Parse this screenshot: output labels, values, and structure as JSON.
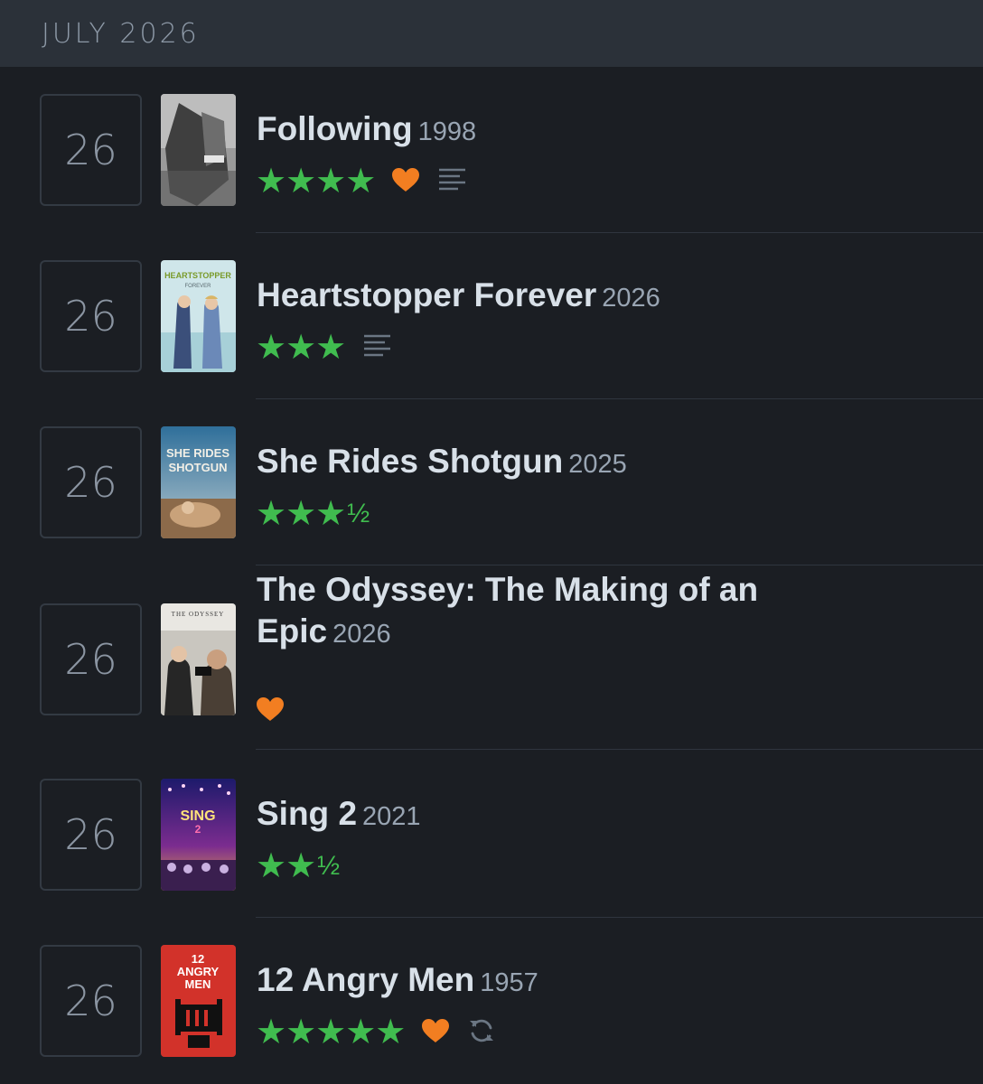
{
  "header": {
    "month": "JULY 2026"
  },
  "colors": {
    "star": "#40bc4f",
    "heart": "#f27e21",
    "icon": "#6b7683"
  },
  "entries": [
    {
      "day": "26",
      "title": "Following",
      "year": "1998",
      "rating": "★★★★",
      "liked": true,
      "review": true,
      "rewatch": false
    },
    {
      "day": "26",
      "title": "Heartstopper Forever",
      "year": "2026",
      "rating": "★★★",
      "liked": false,
      "review": true,
      "rewatch": false
    },
    {
      "day": "26",
      "title": "She Rides Shotgun",
      "year": "2025",
      "rating": "★★★",
      "half": "½",
      "liked": false,
      "review": false,
      "rewatch": false
    },
    {
      "day": "26",
      "title": "The Odyssey: The Making of an Epic",
      "year": "2026",
      "rating": "",
      "liked": true,
      "review": false,
      "rewatch": false
    },
    {
      "day": "26",
      "title": "Sing 2",
      "year": "2021",
      "rating": "★★",
      "half": "½",
      "liked": false,
      "review": false,
      "rewatch": false
    },
    {
      "day": "26",
      "title": "12 Angry Men",
      "year": "1957",
      "rating": "★★★★★",
      "liked": true,
      "review": false,
      "rewatch": true
    }
  ],
  "posters": {
    "heartstopper": {
      "top": "HEARTSTOPPER",
      "sub": "FOREVER"
    },
    "shotgun": {
      "line1": "SHE RIDES",
      "line2": "SHOTGUN"
    },
    "odyssey": {
      "top": "THE ODYSSEY"
    },
    "sing": {
      "text": "SING",
      "num": "2"
    },
    "angry": {
      "line1": "12",
      "line2": "ANGRY",
      "line3": "MEN"
    }
  }
}
